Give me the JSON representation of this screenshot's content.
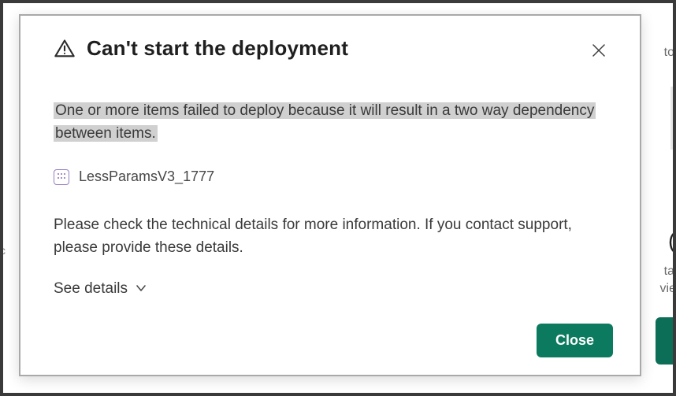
{
  "bg": {
    "frag_top_right": "to",
    "frag_mid_right_1": "ta",
    "frag_mid_right_2": "vie",
    "frag_left": "c"
  },
  "dialog": {
    "title": "Can't start the deployment",
    "message": "One or more items failed to deploy because it will result in a two way dependency between items.",
    "item_name": "LessParamsV3_1777",
    "support_text": "Please check the technical details for more information. If you contact support, please provide these details.",
    "see_details_label": "See details",
    "close_label": "Close"
  },
  "colors": {
    "accent": "#0b7a5e"
  }
}
